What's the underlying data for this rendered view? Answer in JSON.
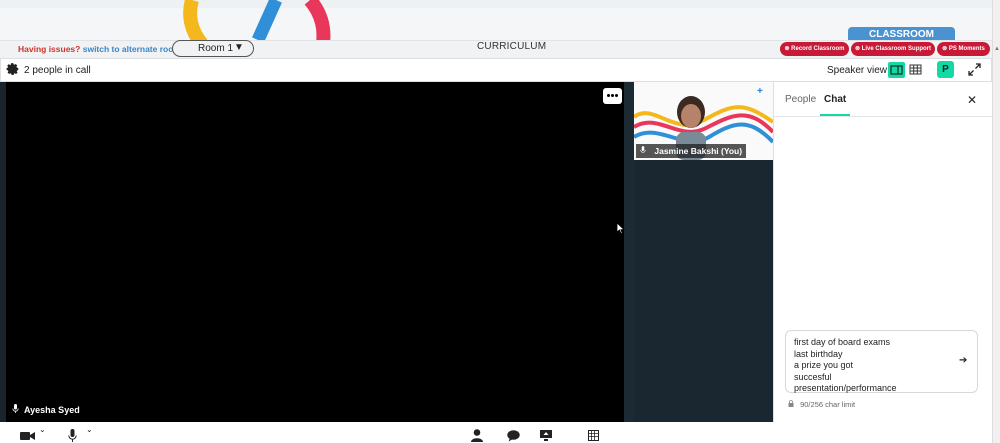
{
  "header": {
    "classroom_tab": "CLASSROOM"
  },
  "toolbar": {
    "issues_text": "Having issues?",
    "alternate_link": "switch to alternate room",
    "room_label": "Room 1",
    "curriculum": "CURRICULUM",
    "record_label": "Record Classroom",
    "support_label": "Live Classroom Support",
    "moments_label": "PS Moments"
  },
  "call": {
    "people_count": "2 people in call",
    "view_label": "Speaker view",
    "avatar_letter": "P"
  },
  "stage": {
    "main_participant": "Ayesha Syed",
    "thumb_participant": "Jasmine Bakshi (You)"
  },
  "panel": {
    "tab_people": "People",
    "tab_chat": "Chat",
    "chat_draft": "first day of board exams\nlast birthday\na prize you got\nsuccesful\npresentation/performance",
    "char_limit": "90/256 char limit"
  },
  "colors": {
    "accent_green": "#14d9a4",
    "pill_red": "#c81a37",
    "classroom_blue": "#4a93d0"
  }
}
